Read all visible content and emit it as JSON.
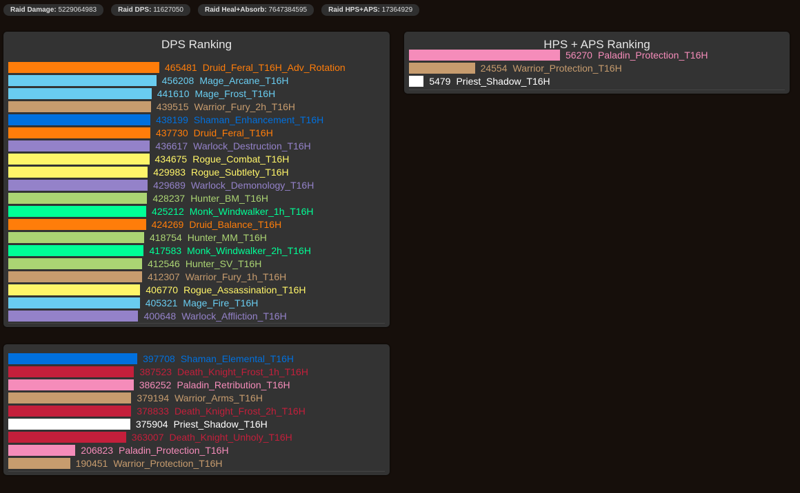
{
  "stats": [
    {
      "label": "Raid Damage:",
      "value": "5229064983"
    },
    {
      "label": "Raid DPS:",
      "value": "11627050"
    },
    {
      "label": "Raid Heal+Absorb:",
      "value": "7647384595"
    },
    {
      "label": "Raid HPS+APS:",
      "value": "17364929"
    }
  ],
  "colors": {
    "Druid": "#FF7D0A",
    "Mage": "#69CCF0",
    "Warrior": "#C79C6E",
    "Shaman": "#0070DE",
    "Warlock": "#9482C9",
    "Rogue": "#FFF569",
    "Hunter": "#ABD473",
    "Monk": "#00FF96",
    "Death": "#C41F3B",
    "Paladin": "#F58CBA",
    "Priest": "#FFFFFF"
  },
  "chart_data": [
    {
      "type": "bar",
      "orientation": "horizontal",
      "title": "DPS Ranking",
      "max": 465481,
      "categories": [
        "Druid_Feral_T16H_Adv_Rotation",
        "Mage_Arcane_T16H",
        "Mage_Frost_T16H",
        "Warrior_Fury_2h_T16H",
        "Shaman_Enhancement_T16H",
        "Druid_Feral_T16H",
        "Warlock_Destruction_T16H",
        "Rogue_Combat_T16H",
        "Rogue_Subtlety_T16H",
        "Warlock_Demonology_T16H",
        "Hunter_BM_T16H",
        "Monk_Windwalker_1h_T16H",
        "Druid_Balance_T16H",
        "Hunter_MM_T16H",
        "Monk_Windwalker_2h_T16H",
        "Hunter_SV_T16H",
        "Warrior_Fury_1h_T16H",
        "Rogue_Assassination_T16H",
        "Mage_Fire_T16H",
        "Warlock_Affliction_T16H"
      ],
      "values": [
        465481,
        456208,
        441610,
        439515,
        438199,
        437730,
        436617,
        434675,
        429983,
        429689,
        428237,
        425212,
        424269,
        418754,
        417583,
        412546,
        412307,
        406770,
        405321,
        400648
      ]
    },
    {
      "type": "bar",
      "orientation": "horizontal",
      "title": "",
      "max": 465481,
      "categories": [
        "Shaman_Elemental_T16H",
        "Death_Knight_Frost_1h_T16H",
        "Paladin_Retribution_T16H",
        "Warrior_Arms_T16H",
        "Death_Knight_Frost_2h_T16H",
        "Priest_Shadow_T16H",
        "Death_Knight_Unholy_T16H",
        "Paladin_Protection_T16H",
        "Warrior_Protection_T16H"
      ],
      "values": [
        397708,
        387523,
        386252,
        379194,
        378833,
        375904,
        363007,
        206823,
        190451
      ]
    },
    {
      "type": "bar",
      "orientation": "horizontal",
      "title": "HPS + APS Ranking",
      "max": 56270,
      "categories": [
        "Paladin_Protection_T16H",
        "Warrior_Protection_T16H",
        "Priest_Shadow_T16H"
      ],
      "values": [
        56270,
        24554,
        5479
      ]
    }
  ]
}
